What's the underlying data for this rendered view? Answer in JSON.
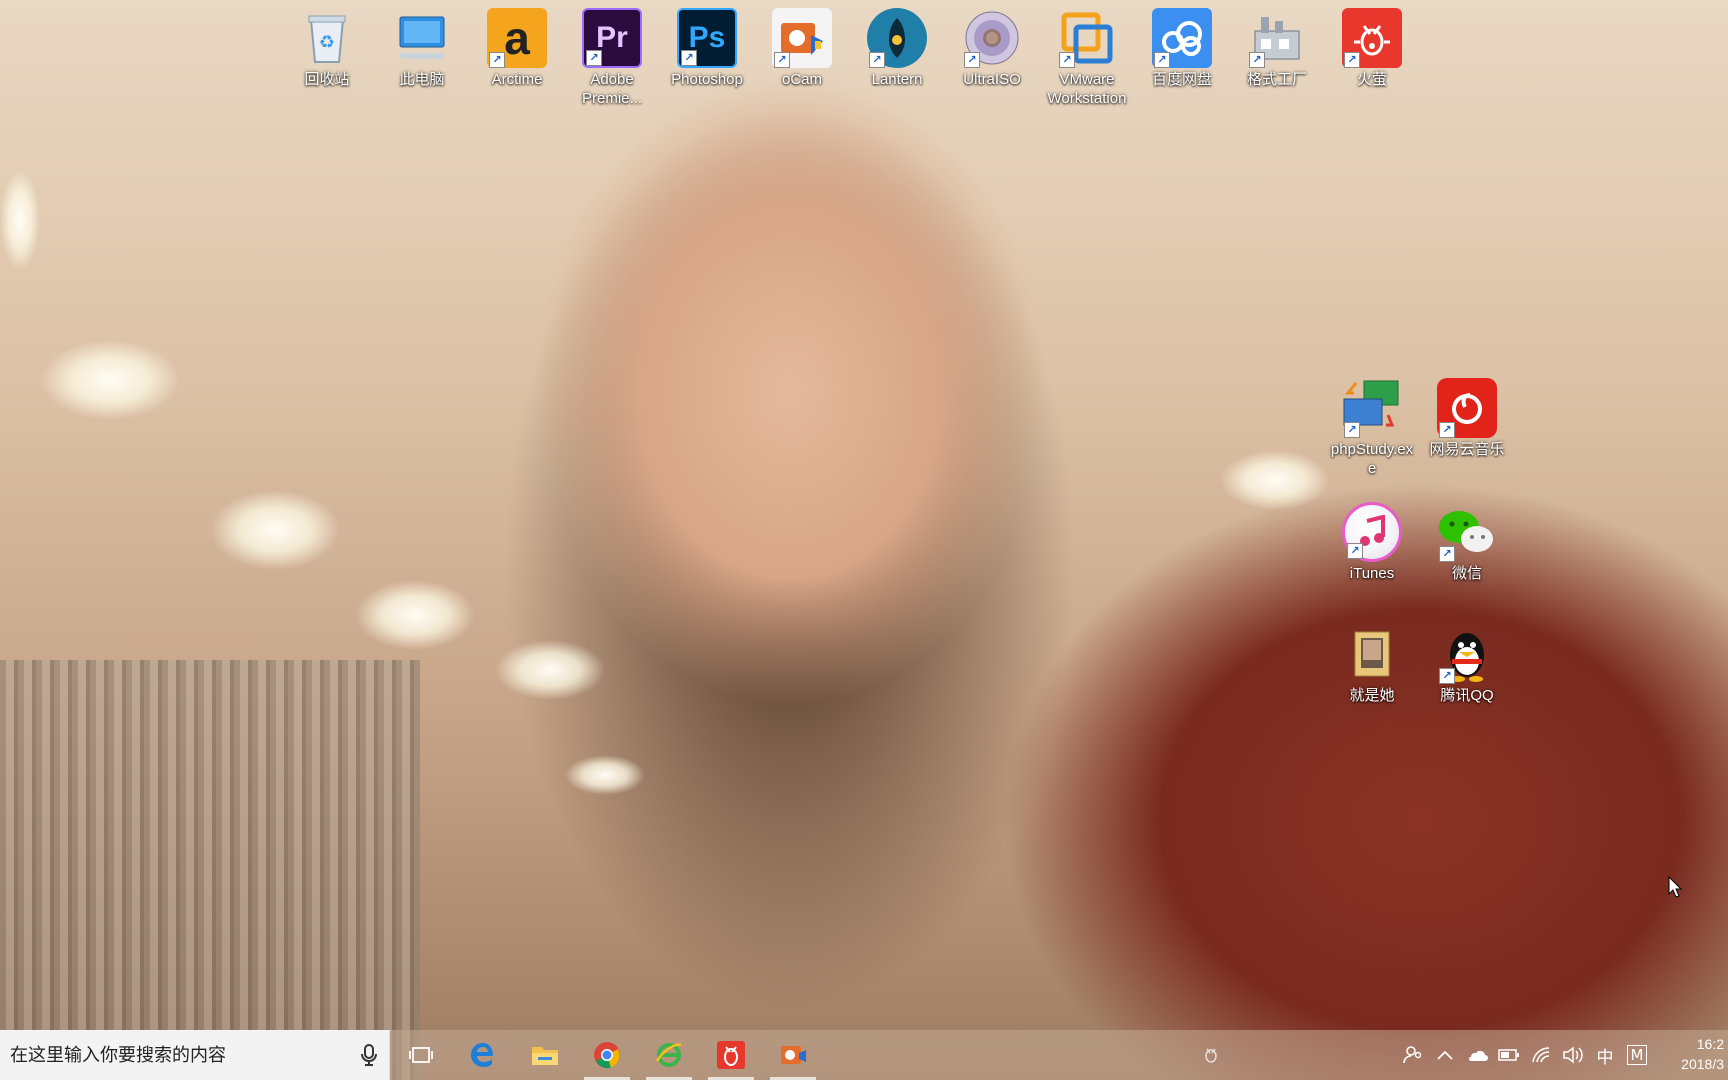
{
  "desktop": {
    "icons": [
      {
        "label": "回收站",
        "icon": "recycle-bin-icon"
      },
      {
        "label": "此电脑",
        "icon": "computer-icon"
      },
      {
        "label": "Arctime",
        "icon": "arctime-icon"
      },
      {
        "label": "Adobe Premie...",
        "icon": "premiere-icon"
      },
      {
        "label": "Photoshop",
        "icon": "photoshop-icon"
      },
      {
        "label": "oCam",
        "icon": "ocam-icon"
      },
      {
        "label": "Lantern",
        "icon": "lantern-icon"
      },
      {
        "label": "UltraISO",
        "icon": "ultraiso-icon"
      },
      {
        "label": "VMware Workstation",
        "icon": "vmware-icon"
      },
      {
        "label": "百度网盘",
        "icon": "baidu-netdisk-icon"
      },
      {
        "label": "格式工厂",
        "icon": "format-factory-icon"
      },
      {
        "label": "火萤",
        "icon": "firefly-icon"
      },
      {
        "label": "phpStudy.exe",
        "icon": "phpstudy-icon"
      },
      {
        "label": "网易云音乐",
        "icon": "netease-music-icon"
      },
      {
        "label": "iTunes",
        "icon": "itunes-icon"
      },
      {
        "label": "微信",
        "icon": "wechat-icon"
      },
      {
        "label": "就是她",
        "icon": "folder-icon"
      },
      {
        "label": "腾讯QQ",
        "icon": "qq-icon"
      }
    ]
  },
  "taskbar": {
    "search_placeholder": "在这里输入你要搜索的内容",
    "apps": [
      "task-view-icon",
      "edge-icon",
      "file-explorer-icon",
      "chrome-icon",
      "ie-icon",
      "firefly-icon",
      "ocam-icon"
    ],
    "tray": {
      "ime_label": "中",
      "ime_mode": "M"
    },
    "clock": {
      "time": "16:2",
      "date": "2018/3"
    }
  },
  "colors": {
    "premiere": "#2b0a3d",
    "photoshop": "#001d34",
    "baidu": "#3b8ff0",
    "firefly": "#e8372c",
    "netease": "#e2231a",
    "wechat": "#2dc100"
  }
}
